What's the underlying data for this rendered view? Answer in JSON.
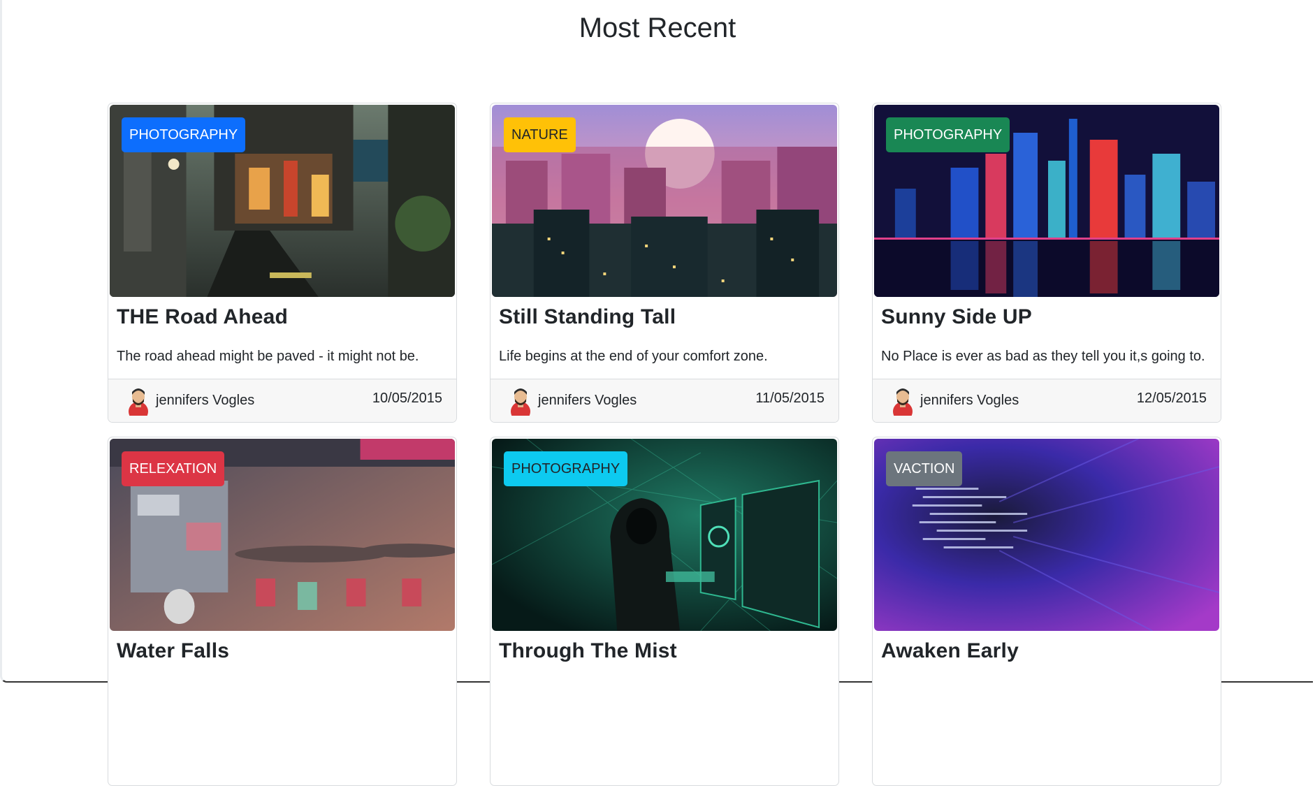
{
  "section_title": "Most Recent",
  "posts": [
    {
      "category": "PHOTOGRAPHY",
      "category_color": "#0d6efd",
      "title": "THE Road Ahead",
      "excerpt": "The road ahead might be paved - it might not be.",
      "author": "jennifers Vogles",
      "date": "10/05/2015",
      "image": "street-alley-night-illustration"
    },
    {
      "category": "NATURE",
      "category_color": "#ffc107",
      "title": "Still Standing Tall",
      "excerpt": "Life begins at the end of your comfort zone.",
      "author": "jennifers Vogles",
      "date": "11/05/2015",
      "image": "pixel-city-sunset-illustration"
    },
    {
      "category": "PHOTOGRAPHY",
      "category_color": "#198754",
      "title": "Sunny Side UP",
      "excerpt": "No Place is ever as bad as they tell you it,s going to.",
      "author": "jennifers Vogles",
      "date": "12/05/2015",
      "image": "neon-skyline-reflection-illustration"
    },
    {
      "category": "RELEXATION",
      "category_color": "#dc3545",
      "title": "Water Falls",
      "image": "street-food-stall-illustration"
    },
    {
      "category": "PHOTOGRAPHY",
      "category_color": "#0dcaf0",
      "title": "Through The Mist",
      "image": "hooded-hacker-illustration"
    },
    {
      "category": "VACTION",
      "category_color": "#6c757d",
      "title": "Awaken Early",
      "image": "code-tunnel-blur-illustration"
    }
  ]
}
